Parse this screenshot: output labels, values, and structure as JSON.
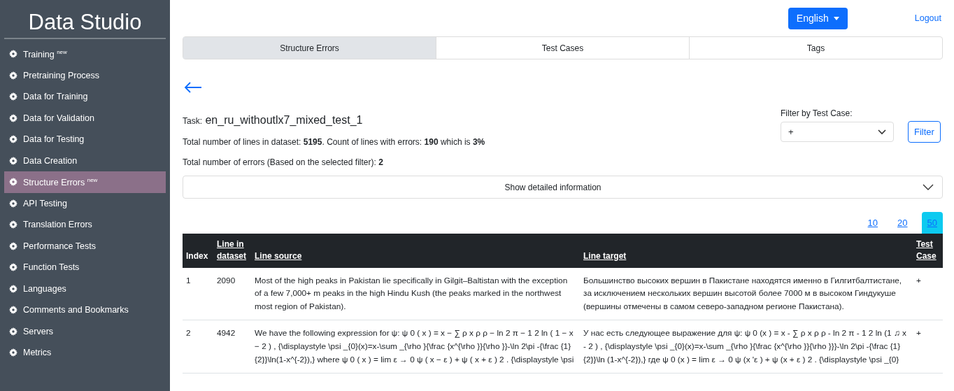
{
  "sidebar": {
    "title": "Data Studio",
    "items": [
      {
        "label": "Training $^{new}$",
        "selected": false
      },
      {
        "label": "Pretraining Process",
        "selected": false
      },
      {
        "label": "Data for Training",
        "selected": false
      },
      {
        "label": "Data for Validation",
        "selected": false
      },
      {
        "label": "Data for Testing",
        "selected": false
      },
      {
        "label": "Data Creation",
        "selected": false
      },
      {
        "label": "Structure Errors $^{new}$",
        "selected": true
      },
      {
        "label": "API Testing",
        "selected": false
      },
      {
        "label": "Translation Errors",
        "selected": false
      },
      {
        "label": "Performance Tests",
        "selected": false
      },
      {
        "label": "Function Tests",
        "selected": false
      },
      {
        "label": "Languages",
        "selected": false
      },
      {
        "label": "Comments and Bookmarks",
        "selected": false
      },
      {
        "label": "Servers",
        "selected": false
      },
      {
        "label": "Metrics",
        "selected": false
      }
    ]
  },
  "header": {
    "language": "English",
    "logout": "Logout"
  },
  "tabs": [
    {
      "label": "Structure Errors",
      "selected": true
    },
    {
      "label": "Test Cases",
      "selected": false
    },
    {
      "label": "Tags",
      "selected": false
    }
  ],
  "task": {
    "label": "Task:",
    "name": "en_ru_withoutlx7_mixed_test_1"
  },
  "summary": "Total number of lines in dataset: **5195**. Count of lines with errors: **190** which is **3%**",
  "errors_total": "Total number of errors (Based on the selected filter): **2**",
  "filter": {
    "label": "Filter by Test Case:",
    "value": "+",
    "button": "Filter"
  },
  "details": {
    "label": "Show detailed information"
  },
  "page_sizes": [
    {
      "label": "10",
      "selected": false
    },
    {
      "label": "20",
      "selected": false
    },
    {
      "label": "50",
      "selected": true
    }
  ],
  "table": {
    "columns": [
      "Index",
      "Line in dataset",
      "Line source",
      "Line target",
      "Test Case"
    ],
    "rows": [
      {
        "index": "1",
        "line": "2090",
        "source": "Most of the high peaks in Pakistan lie specifically in Gilgit–Baltistan with the exception of a few 7,000+ m peaks in the high Hindu Kush (the peaks marked in the northwest most region of Pakistan).",
        "target": "Большинство высоких вершин в Пакистане находятся именно в Гилгитбалтистане, за исключением нескольких вершин высотой более 7000 м в высоком Гиндукуше (вершины отмечены в самом северо-западном регионе Пакистана).",
        "test_case": "+"
      },
      {
        "index": "2",
        "line": "4942",
        "source": "We have the following expression for ψ: ψ 0 ( x ) = x − ∑ ρ x ρ ρ − ln  2 π − 1 2 ln  ( 1 − x − 2 ) , {\\displaystyle \\psi _{0}(x)=x-\\sum _{\\rho }{\\frac {x^{\\rho }}{\\rho }}-\\ln 2\\pi -{\\frac {1}{2}}\\ln(1-x^{-2}),} where ψ 0 ( x ) = lim ε → 0 ψ ( x − ε ) + ψ ( x + ε ) 2 . {\\displaystyle \\psi",
        "target": "У нас есть следующее выражение для ψ: ψ 0 (x ) = x - ∑ ρ x ρ ρ - ln  2 π - 1 2 ln  (1 ♫ x - 2 ) , {\\displaystyle \\psi _{0}(x)=x-\\sum _{\\rho }{\\frac {x^{\\rho }}{\\rho }}}-\\ln 2\\pi -{\\frac {1}{2}}\\ln (1-x^{-2}),} где ψ 0 (x ) = lim ε → 0 ψ (x 'ε ) + ψ (x + ε ) 2 . {\\displaystyle \\psi _{0}",
        "test_case": "+"
      }
    ]
  }
}
